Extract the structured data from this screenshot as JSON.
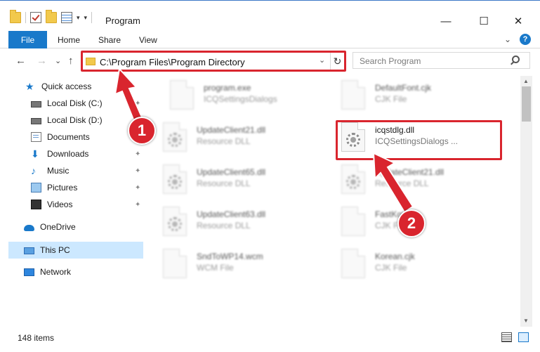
{
  "window": {
    "title": "Program",
    "controls": {
      "minimize": "—",
      "maximize": "☐",
      "close": "✕"
    }
  },
  "ribbon": {
    "tabs": [
      "File",
      "Home",
      "Share",
      "View"
    ],
    "help": "?"
  },
  "nav": {
    "back": "←",
    "forward": "→",
    "recent": "⌄",
    "up": "↑"
  },
  "address": {
    "path": "C:\\Program Files\\Program Directory",
    "refresh": "↻",
    "dropdown": "⌄"
  },
  "search": {
    "placeholder": "Search Program"
  },
  "sidebar": {
    "items": [
      {
        "label": "Quick access",
        "icon": "star-icon",
        "pinned": false
      },
      {
        "label": "Local Disk (C:)",
        "icon": "drive-icon",
        "pinned": true
      },
      {
        "label": "Local Disk (D:)",
        "icon": "drive-icon",
        "pinned": true
      },
      {
        "label": "Documents",
        "icon": "documents-icon",
        "pinned": true
      },
      {
        "label": "Downloads",
        "icon": "downloads-icon",
        "pinned": true
      },
      {
        "label": "Music",
        "icon": "music-icon",
        "pinned": true
      },
      {
        "label": "Pictures",
        "icon": "pictures-icon",
        "pinned": true
      },
      {
        "label": "Videos",
        "icon": "videos-icon",
        "pinned": true
      },
      {
        "label": "OneDrive",
        "icon": "onedrive-icon",
        "pinned": false
      },
      {
        "label": "This PC",
        "icon": "this-pc-icon",
        "pinned": false,
        "selected": true
      },
      {
        "label": "Network",
        "icon": "network-icon",
        "pinned": false
      }
    ]
  },
  "files": [
    {
      "name": "program.exe",
      "desc": "ICQSettingsDialogs",
      "blurred": true
    },
    {
      "name": "DefaultFont.cjk",
      "desc": "CJK File",
      "blurred": true
    },
    {
      "name": "UpdateClient21.dll",
      "desc": "Resource DLL",
      "blurred": true
    },
    {
      "name": "icqstdlg.dll",
      "desc": "ICQSettingsDialogs ...",
      "blurred": false
    },
    {
      "name": "UpdateClient65.dll",
      "desc": "Resource DLL",
      "blurred": true
    },
    {
      "name": "UpdateClient21.dll",
      "desc": "Resource DLL",
      "blurred": true
    },
    {
      "name": "UpdateClient63.dll",
      "desc": "Resource DLL",
      "blurred": true
    },
    {
      "name": "FastKorean",
      "desc": "CJK File",
      "blurred": true
    },
    {
      "name": "SndToWP14.wcm",
      "desc": "WCM File",
      "blurred": true
    },
    {
      "name": "Korean.cjk",
      "desc": "CJK File",
      "blurred": true
    }
  ],
  "status": {
    "count": "148 items"
  },
  "callouts": [
    {
      "number": "1"
    },
    {
      "number": "2"
    }
  ],
  "colors": {
    "accent": "#1979ca",
    "highlight": "#d9252e",
    "selection": "#cce8ff"
  }
}
